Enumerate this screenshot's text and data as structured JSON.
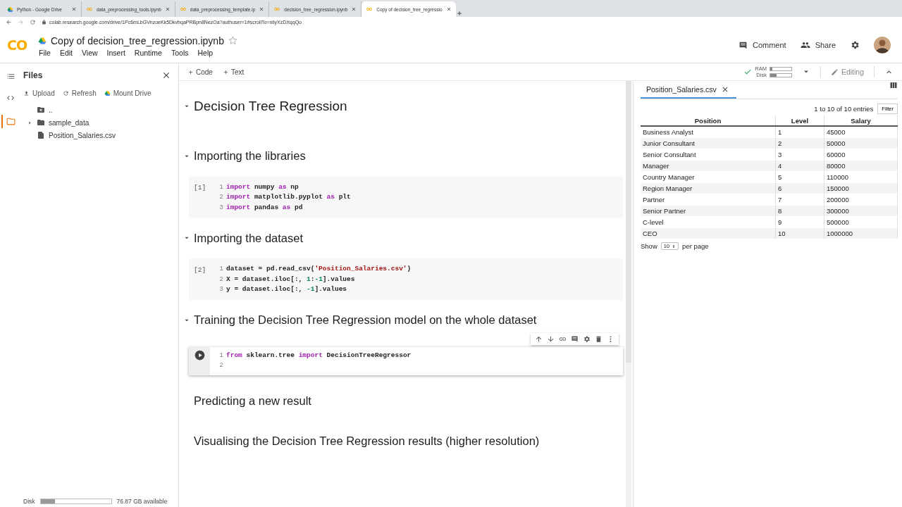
{
  "browser": {
    "tabs": [
      {
        "title": "Python - Google Drive",
        "kind": "drive",
        "selected": false
      },
      {
        "title": "data_preprocessing_tools.ipynb",
        "kind": "colab",
        "selected": false
      },
      {
        "title": "data_preprocessing_template.ip",
        "kind": "colab",
        "selected": false
      },
      {
        "title": "decision_tree_regression.ipynb",
        "kind": "colab",
        "selected": false
      },
      {
        "title": "Copy of decision_tree_regressio",
        "kind": "colab",
        "selected": true
      }
    ],
    "url": "colab.research.google.com/drive/1Pc6mLbGVnzoeKk5DkvbqaPRBpn8NezOa?authuser=1#scrollTo=nilyXzDXqqQo"
  },
  "header": {
    "logo": "CO",
    "title": "Copy of decision_tree_regression.ipynb",
    "menu": [
      "File",
      "Edit",
      "View",
      "Insert",
      "Runtime",
      "Tools",
      "Help"
    ],
    "comment": "Comment",
    "share": "Share"
  },
  "sidebar": {
    "title": "Files",
    "actions": [
      "Upload",
      "Refresh",
      "Mount Drive"
    ],
    "tree": [
      {
        "name": "..",
        "kind": "parent"
      },
      {
        "name": "sample_data",
        "kind": "folder",
        "expanded": false
      },
      {
        "name": "Position_Salaries.csv",
        "kind": "file"
      }
    ],
    "disk": {
      "label": "Disk",
      "level": 0.2,
      "reading": "76.87 GB available"
    }
  },
  "toolbar": {
    "add": [
      "Code",
      "Text"
    ],
    "ram_label": "RAM",
    "disk_label": "Disk",
    "ram": {
      "level": 0.1
    },
    "disk": {
      "level": 0.3
    },
    "mode": "Editing"
  },
  "cells": [
    {
      "kind": "title",
      "text": "Decision Tree Regression",
      "collapsible": true
    },
    {
      "kind": "heading",
      "text": "Importing the libraries",
      "collapsible": true
    },
    {
      "kind": "code",
      "prompt": "[1]",
      "focused": false,
      "lines": [
        {
          "number": "1",
          "tokens": [
            {
              "text": "import",
              "kind": "kw"
            },
            {
              "text": " numpy ",
              "kind": "plain"
            },
            {
              "text": "as",
              "kind": "kw"
            },
            {
              "text": " np",
              "kind": "plain"
            }
          ]
        },
        {
          "number": "2",
          "tokens": [
            {
              "text": "import",
              "kind": "kw"
            },
            {
              "text": " matplotlib.pyplot ",
              "kind": "plain"
            },
            {
              "text": "as",
              "kind": "kw"
            },
            {
              "text": " plt",
              "kind": "plain"
            }
          ]
        },
        {
          "number": "3",
          "tokens": [
            {
              "text": "import",
              "kind": "kw"
            },
            {
              "text": " pandas ",
              "kind": "plain"
            },
            {
              "text": "as",
              "kind": "kw"
            },
            {
              "text": " pd",
              "kind": "plain"
            }
          ]
        }
      ]
    },
    {
      "kind": "heading",
      "text": "Importing the dataset",
      "collapsible": true
    },
    {
      "kind": "code",
      "prompt": "[2]",
      "focused": false,
      "lines": [
        {
          "number": "1",
          "tokens": [
            {
              "text": "dataset = pd.read_csv(",
              "kind": "plain"
            },
            {
              "text": "'Position_Salaries.csv'",
              "kind": "str"
            },
            {
              "text": ")",
              "kind": "plain"
            }
          ]
        },
        {
          "number": "2",
          "tokens": [
            {
              "text": "X = dataset.iloc[:, ",
              "kind": "plain"
            },
            {
              "text": "1",
              "kind": "num"
            },
            {
              "text": ":",
              "kind": "plain"
            },
            {
              "text": "-1",
              "kind": "num"
            },
            {
              "text": "].values",
              "kind": "plain"
            }
          ]
        },
        {
          "number": "3",
          "tokens": [
            {
              "text": "y = dataset.iloc[:, ",
              "kind": "plain"
            },
            {
              "text": "-1",
              "kind": "num"
            },
            {
              "text": "].values",
              "kind": "plain"
            }
          ]
        }
      ]
    },
    {
      "kind": "heading",
      "text": "Training the Decision Tree Regression model on the whole dataset",
      "collapsible": true
    },
    {
      "kind": "code",
      "focused": true,
      "lines": [
        {
          "number": "1",
          "tokens": [
            {
              "text": "from",
              "kind": "kw"
            },
            {
              "text": " sklearn.tree ",
              "kind": "plain"
            },
            {
              "text": "import",
              "kind": "kw"
            },
            {
              "text": " DecisionTreeRegressor",
              "kind": "plain"
            }
          ]
        },
        {
          "number": "2"
        }
      ]
    },
    {
      "kind": "heading",
      "text": "Predicting a new result",
      "collapsible": false
    },
    {
      "kind": "heading",
      "text": "Visualising the Decision Tree Regression results (higher resolution)",
      "collapsible": false
    }
  ],
  "viewer": {
    "tab": "Position_Salaries.csv",
    "entries": "1 to 10 of 10 entries",
    "filter": "Filter",
    "columns": [
      "Position",
      "Level",
      "Salary"
    ],
    "rows": [
      [
        "Business Analyst",
        "1",
        "45000"
      ],
      [
        "Junior Consultant",
        "2",
        "50000"
      ],
      [
        "Senior Consultant",
        "3",
        "60000"
      ],
      [
        "Manager",
        "4",
        "80000"
      ],
      [
        "Country Manager",
        "5",
        "110000"
      ],
      [
        "Region Manager",
        "6",
        "150000"
      ],
      [
        "Partner",
        "7",
        "200000"
      ],
      [
        "Senior Partner",
        "8",
        "300000"
      ],
      [
        "C-level",
        "9",
        "500000"
      ],
      [
        "CEO",
        "10",
        "1000000"
      ]
    ],
    "show": "Show",
    "page_size": "10",
    "per_page": "per page"
  }
}
